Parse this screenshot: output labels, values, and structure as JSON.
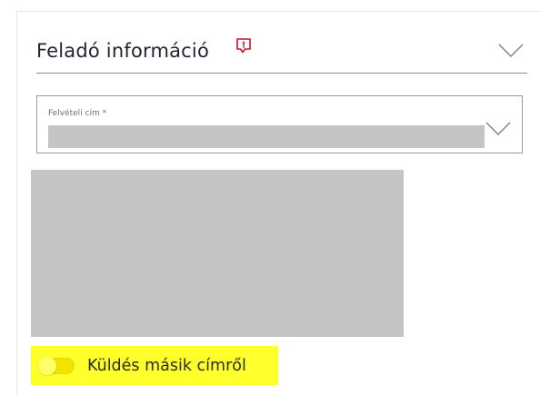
{
  "section": {
    "title": "Feladó információ",
    "info_icon": "info-comment-icon",
    "collapse_icon": "chevron-down-icon"
  },
  "pickup_address": {
    "label": "Felvételi cím *",
    "value_redacted": true,
    "dropdown_icon": "chevron-down-icon"
  },
  "map": {
    "redacted": true
  },
  "send_from_other_address": {
    "label": "Küldés másik címről",
    "enabled": false
  },
  "colors": {
    "accent": "#c8102e",
    "highlight": "#ffff2b",
    "redaction": "#c4c4c4",
    "text": "#1f2530"
  }
}
